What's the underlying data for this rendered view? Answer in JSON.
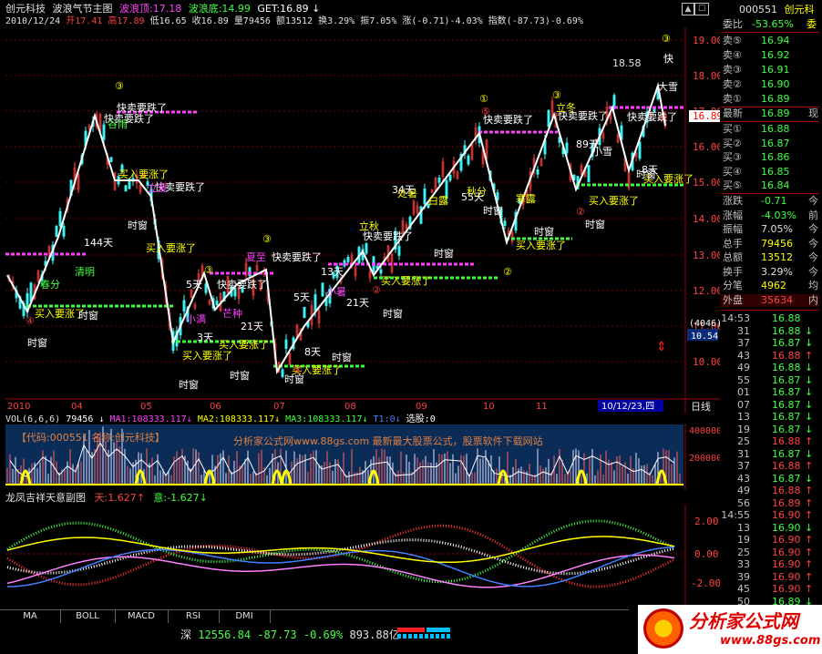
{
  "colors": {
    "up": "#ff4040",
    "down": "#00d060",
    "white": "#ffffff",
    "yellow": "#ffff00",
    "magenta": "#ff40ff",
    "cyan": "#00ffff",
    "green": "#40ff40",
    "grid": "#a00000",
    "panel_blue": "#0a2a5a"
  },
  "header": {
    "stock_name": "创元科技",
    "indicator": "波浪气节主图",
    "wave_top_label": "波浪顶:17.18",
    "wave_bottom_label": "波浪底:14.99",
    "get_label": "GET:16.89",
    "date": "2010/12/24",
    "open": "开17.41",
    "high": "高17.89",
    "low": "低16.65",
    "close": "收16.89",
    "volume": "量79456",
    "amount": "额13512",
    "turnover": "换3.29%",
    "amplitude": "振7.05%",
    "change": "涨(-0.71)-4.03%",
    "index": "指数(-87.73)-0.69%"
  },
  "right_panel": {
    "code": "000551",
    "name": "创元科",
    "weibi_label": "委比",
    "weibi_value": "-53.65%",
    "weibi_extra": "委",
    "asks": [
      {
        "label": "卖⑤",
        "price": "16.94"
      },
      {
        "label": "卖④",
        "price": "16.92"
      },
      {
        "label": "卖③",
        "price": "16.91"
      },
      {
        "label": "卖②",
        "price": "16.90"
      },
      {
        "label": "卖①",
        "price": "16.89"
      }
    ],
    "latest_label": "最新",
    "latest_value": "16.89",
    "latest_extra": "现",
    "bids": [
      {
        "label": "买①",
        "price": "16.88"
      },
      {
        "label": "买②",
        "price": "16.87"
      },
      {
        "label": "买③",
        "price": "16.86"
      },
      {
        "label": "买④",
        "price": "16.85"
      },
      {
        "label": "买⑤",
        "price": "16.84"
      }
    ],
    "stats": [
      {
        "label": "涨跌",
        "value": "-0.71",
        "extra": "今"
      },
      {
        "label": "涨幅",
        "value": "-4.03%",
        "extra": "前"
      },
      {
        "label": "振幅",
        "value": "7.05%",
        "extra": "今"
      },
      {
        "label": "总手",
        "value": "79456",
        "extra": "今"
      },
      {
        "label": "总额",
        "value": "13512",
        "extra": "今"
      },
      {
        "label": "换手",
        "value": "3.29%",
        "extra": "今"
      },
      {
        "label": "分笔",
        "value": "4962",
        "extra": "均"
      }
    ],
    "outer_label": "外盘",
    "outer_value": "35634",
    "outer_extra": "内",
    "ticks": [
      {
        "time": "14:53",
        "price": "16.88",
        "arrow": ""
      },
      {
        "time": "31",
        "price": "16.88",
        "arrow": "↓"
      },
      {
        "time": "37",
        "price": "16.87",
        "arrow": "↓"
      },
      {
        "time": "43",
        "price": "16.88",
        "arrow": "↑"
      },
      {
        "time": "49",
        "price": "16.88",
        "arrow": "↓"
      },
      {
        "time": "55",
        "price": "16.87",
        "arrow": "↓"
      },
      {
        "time": "01",
        "price": "16.87",
        "arrow": "↓"
      },
      {
        "time": "07",
        "price": "16.87",
        "arrow": "↓"
      },
      {
        "time": "13",
        "price": "16.87",
        "arrow": "↓"
      },
      {
        "time": "19",
        "price": "16.87",
        "arrow": "↓"
      },
      {
        "time": "25",
        "price": "16.88",
        "arrow": "↑"
      },
      {
        "time": "31",
        "price": "16.87",
        "arrow": "↓"
      },
      {
        "time": "37",
        "price": "16.88",
        "arrow": "↑"
      },
      {
        "time": "43",
        "price": "16.87",
        "arrow": "↓"
      },
      {
        "time": "49",
        "price": "16.88",
        "arrow": "↑"
      },
      {
        "time": "56",
        "price": "16.89",
        "arrow": "↑"
      },
      {
        "time": "14:55",
        "price": "16.90",
        "arrow": "↑"
      },
      {
        "time": "13",
        "price": "16.90",
        "arrow": "↓"
      },
      {
        "time": "19",
        "price": "16.90",
        "arrow": "↑"
      },
      {
        "time": "25",
        "price": "16.90",
        "arrow": "↑"
      },
      {
        "time": "33",
        "price": "16.90",
        "arrow": "↑"
      },
      {
        "time": "39",
        "price": "16.90",
        "arrow": "↑"
      },
      {
        "time": "45",
        "price": "16.90",
        "arrow": "↑"
      },
      {
        "time": "50",
        "price": "16.89",
        "arrow": "↓"
      }
    ]
  },
  "main_chart": {
    "price_axis": [
      "19.00",
      "18.00",
      "17.00",
      "16.00",
      "15.00",
      "14.00",
      "13.00",
      "12.00",
      "11.00",
      "10.00"
    ],
    "current_price_tag": "16.89",
    "high_label": "18.58",
    "count_badge": "(4046)",
    "value_badge": "10.54",
    "months": [
      "2010",
      "04",
      "05",
      "06",
      "07",
      "08",
      "09",
      "10",
      "11"
    ],
    "date_highlight": "10/12/23,四",
    "period": "日线",
    "labels": {
      "sell": "快卖要跌了",
      "buy": "买入要涨了",
      "window": "时窗",
      "fast": "快"
    },
    "solar_terms": [
      "春分",
      "清明",
      "谷雨",
      "立夏",
      "小满",
      "芒种",
      "夏至",
      "小暑",
      "立秋",
      "处暑",
      "白露",
      "秋分",
      "寒露",
      "霜降",
      "立冬",
      "小雪",
      "大雪"
    ],
    "day_counts": [
      "144天",
      "5天",
      "3天",
      "21天",
      "5天",
      "13天",
      "21天",
      "8天",
      "34天",
      "55天",
      "89天",
      "8天"
    ]
  },
  "volume_panel": {
    "title": "VOL(6,6,6)",
    "vol": "79456",
    "ma1": "MA1:108333.117",
    "ma2": "MA2:108333.117",
    "ma3": "MA3:108333.117",
    "t1": "T1:0",
    "select": "选股:0",
    "code_text": "【代码:000551 名称:创元科技】",
    "ad_text": "分析家公式网www.88gs.com 最新最大股票公式，股票软件下载网站",
    "axis": [
      "400000",
      "200000"
    ]
  },
  "osc_panel": {
    "title": "龙凤吉祥天意副图",
    "tian": "天:1.627",
    "yi": "意:-1.627",
    "axis": [
      "2.00",
      "0.00",
      "-2.00"
    ]
  },
  "tabs": [
    "MA",
    "BOLL",
    "MACD",
    "RSI",
    "DMI"
  ],
  "status": {
    "market": "深",
    "index_value": "12556.84",
    "index_change": "-87.73",
    "index_pct": "-0.69%",
    "amount": "893.88亿"
  },
  "logo": {
    "text": "分析家公式网",
    "url": "www.88gs.com"
  }
}
